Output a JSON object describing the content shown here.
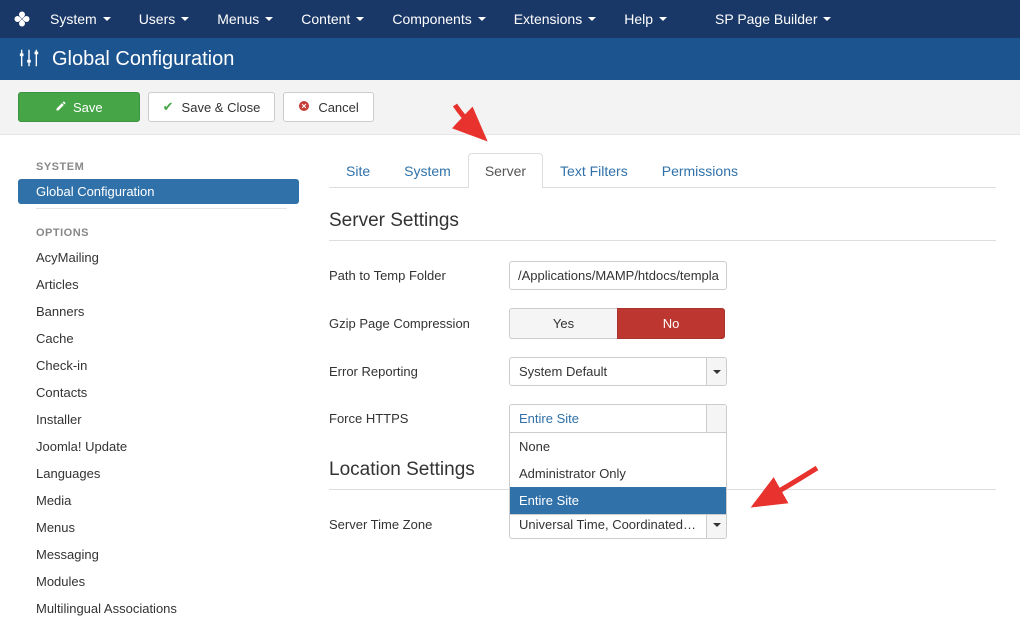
{
  "topmenu": {
    "items": [
      {
        "label": "System"
      },
      {
        "label": "Users"
      },
      {
        "label": "Menus"
      },
      {
        "label": "Content"
      },
      {
        "label": "Components"
      },
      {
        "label": "Extensions"
      },
      {
        "label": "Help"
      },
      {
        "label": "SP Page Builder"
      }
    ]
  },
  "page_title": "Global Configuration",
  "toolbar": {
    "save": "Save",
    "save_close": "Save & Close",
    "cancel": "Cancel"
  },
  "sidebar": {
    "system_heading": "SYSTEM",
    "system_items": [
      {
        "label": "Global Configuration",
        "active": true
      }
    ],
    "options_heading": "OPTIONS",
    "options_items": [
      {
        "label": "AcyMailing"
      },
      {
        "label": "Articles"
      },
      {
        "label": "Banners"
      },
      {
        "label": "Cache"
      },
      {
        "label": "Check-in"
      },
      {
        "label": "Contacts"
      },
      {
        "label": "Installer"
      },
      {
        "label": "Joomla! Update"
      },
      {
        "label": "Languages"
      },
      {
        "label": "Media"
      },
      {
        "label": "Menus"
      },
      {
        "label": "Messaging"
      },
      {
        "label": "Modules"
      },
      {
        "label": "Multilingual Associations"
      }
    ]
  },
  "tabs": [
    {
      "label": "Site"
    },
    {
      "label": "System"
    },
    {
      "label": "Server",
      "active": true
    },
    {
      "label": "Text Filters"
    },
    {
      "label": "Permissions"
    }
  ],
  "sections": {
    "server_settings": {
      "title": "Server Settings",
      "path_tmp": {
        "label": "Path to Temp Folder",
        "value": "/Applications/MAMP/htdocs/templa"
      },
      "gzip": {
        "label": "Gzip Page Compression",
        "yes": "Yes",
        "no": "No",
        "value": "No"
      },
      "error_reporting": {
        "label": "Error Reporting",
        "value": "System Default"
      },
      "force_https": {
        "label": "Force HTTPS",
        "selected": "Entire Site",
        "options": [
          "None",
          "Administrator Only",
          "Entire Site"
        ]
      }
    },
    "location_settings": {
      "title": "Location Settings",
      "timezone": {
        "label": "Server Time Zone",
        "value": "Universal Time, Coordinated …"
      }
    }
  }
}
